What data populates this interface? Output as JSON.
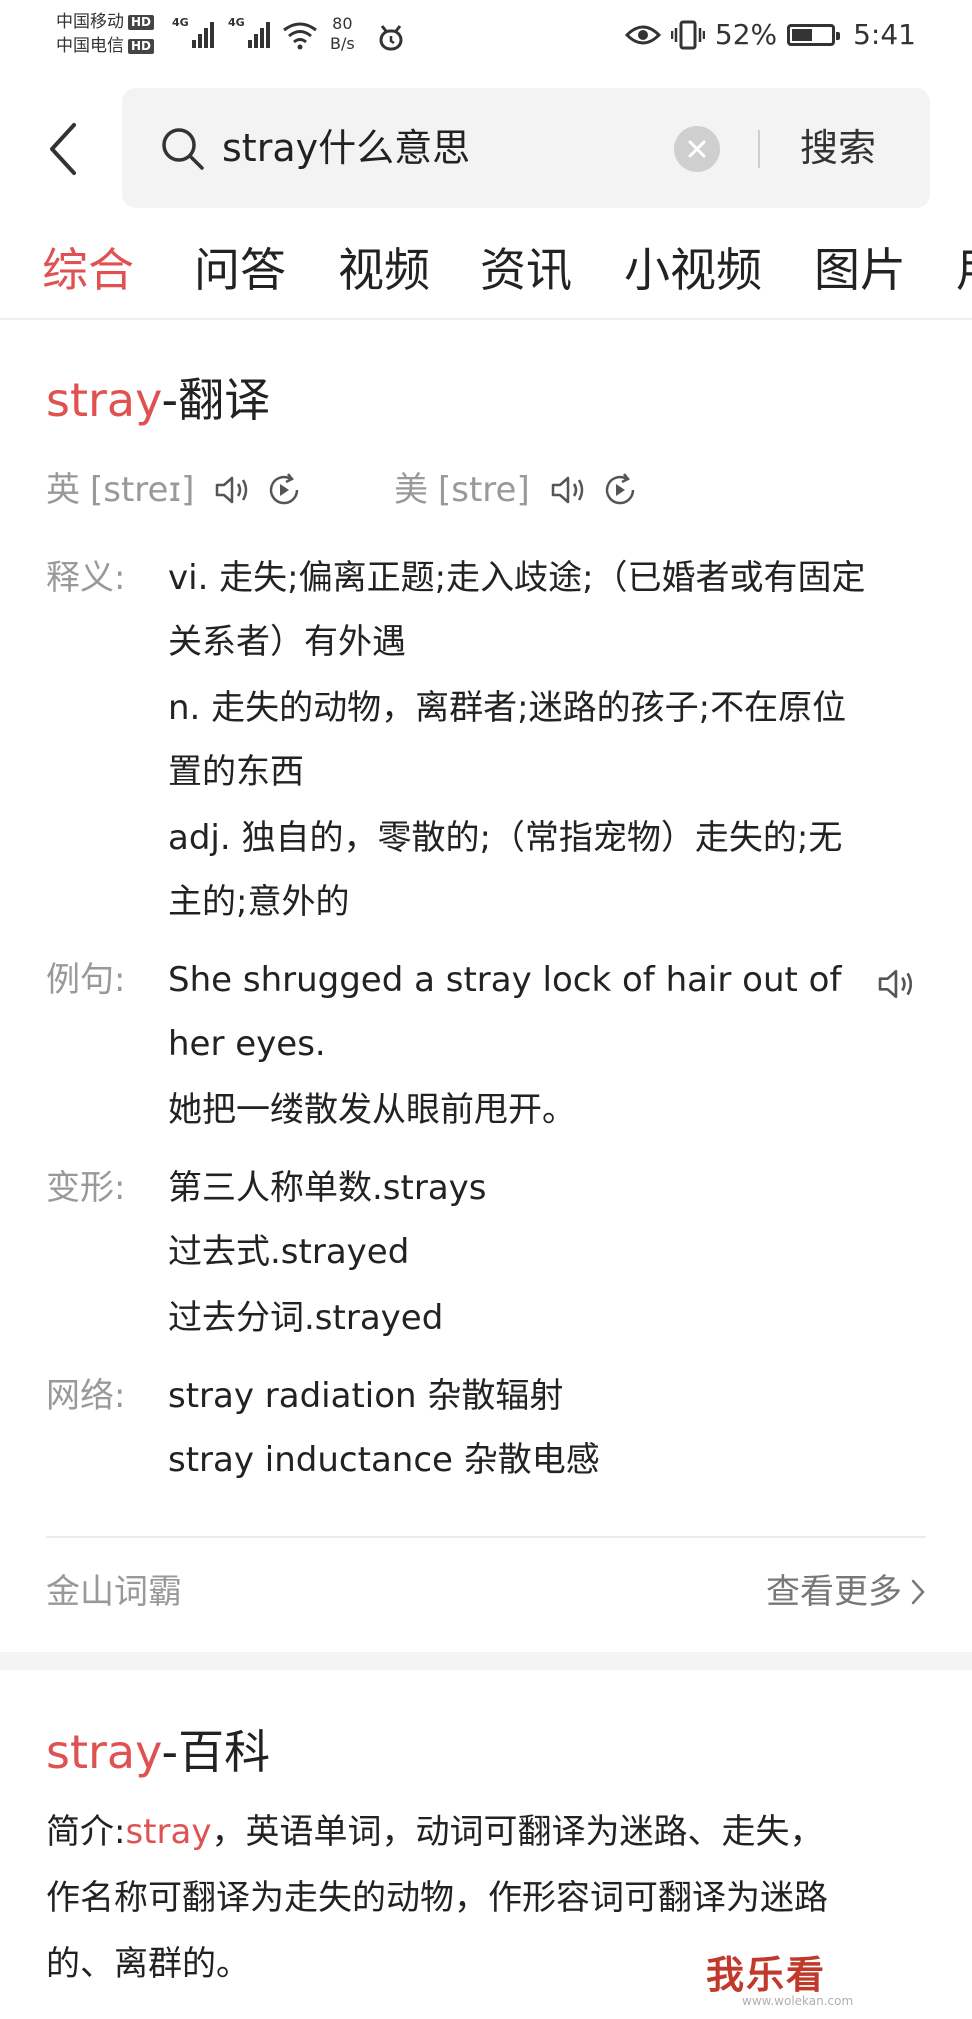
{
  "status_bar": {
    "carrier1": "中国移动",
    "carrier2": "中国电信",
    "hd": "HD",
    "net1": "4G",
    "net2": "4G",
    "speed_value": "80",
    "speed_unit": "B/s",
    "battery_percent": "52%",
    "battery_level": 0.52,
    "time": "5:41"
  },
  "search": {
    "query": "stray什么意思",
    "search_button": "搜索"
  },
  "tabs": [
    "综合",
    "问答",
    "视频",
    "资讯",
    "小视频",
    "图片",
    "用"
  ],
  "translation": {
    "keyword": "stray",
    "title_suffix": "-翻译",
    "uk_label": "英",
    "uk_phonetic": "[streɪ]",
    "us_label": "美",
    "us_phonetic": "[stre]",
    "def_label": "释义:",
    "definitions": [
      "vi. 走失;偏离正题;走入歧途;（已婚者或有固定",
      "关系者）有外遇",
      "n. 走失的动物，离群者;迷路的孩子;不在原位",
      "置的东西",
      "adj. 独自的，零散的;（常指宠物）走失的;无",
      "主的;意外的"
    ],
    "example_label": "例句:",
    "example_lines": [
      "She shrugged a stray lock of hair out of",
      "her eyes.",
      "她把一缕散发从眼前甩开。"
    ],
    "forms_label": "变形:",
    "forms": [
      "第三人称单数.strays",
      "过去式.strayed",
      "过去分词.strayed"
    ],
    "web_label": "网络:",
    "web": [
      "stray radiation 杂散辐射",
      "stray inductance 杂散电感"
    ],
    "source": "金山词霸",
    "more": "查看更多"
  },
  "baike": {
    "keyword": "stray",
    "title_suffix": "-百科",
    "intro_label": "简介:",
    "intro_keyword": "stray",
    "intro_line1_rest": "，英语单词，动词可翻译为迷路、走失，",
    "intro_line2": "作名称可翻译为走失的动物，作形容词可翻译为迷路",
    "intro_line3": "的、离群的。"
  },
  "watermark": {
    "text": "我乐看",
    "url": "www.wolekan.com"
  },
  "colors": {
    "accent": "#e05252",
    "muted_text": "#999999",
    "body_text": "#222222",
    "search_bg": "#f3f3f3"
  }
}
